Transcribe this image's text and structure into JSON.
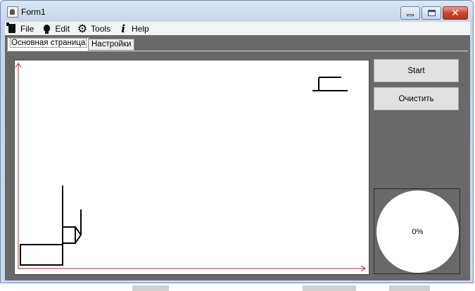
{
  "window": {
    "title": "Form1"
  },
  "menu": [
    {
      "label": "File",
      "icon": "file-icon"
    },
    {
      "label": "Edit",
      "icon": "lightbulb-icon"
    },
    {
      "label": "Tools",
      "icon": "gear-icon"
    },
    {
      "label": "Help",
      "icon": "info-icon"
    }
  ],
  "tabs": [
    {
      "label": "Основная страница",
      "active": true
    },
    {
      "label": "Настройки",
      "active": false
    }
  ],
  "buttons": {
    "start": "Start",
    "clear": "Очистить"
  },
  "progress": {
    "text": "0%",
    "value": 0
  },
  "colors": {
    "axis": "#cc2222",
    "drawing": "#000000",
    "panel": "#696969"
  }
}
